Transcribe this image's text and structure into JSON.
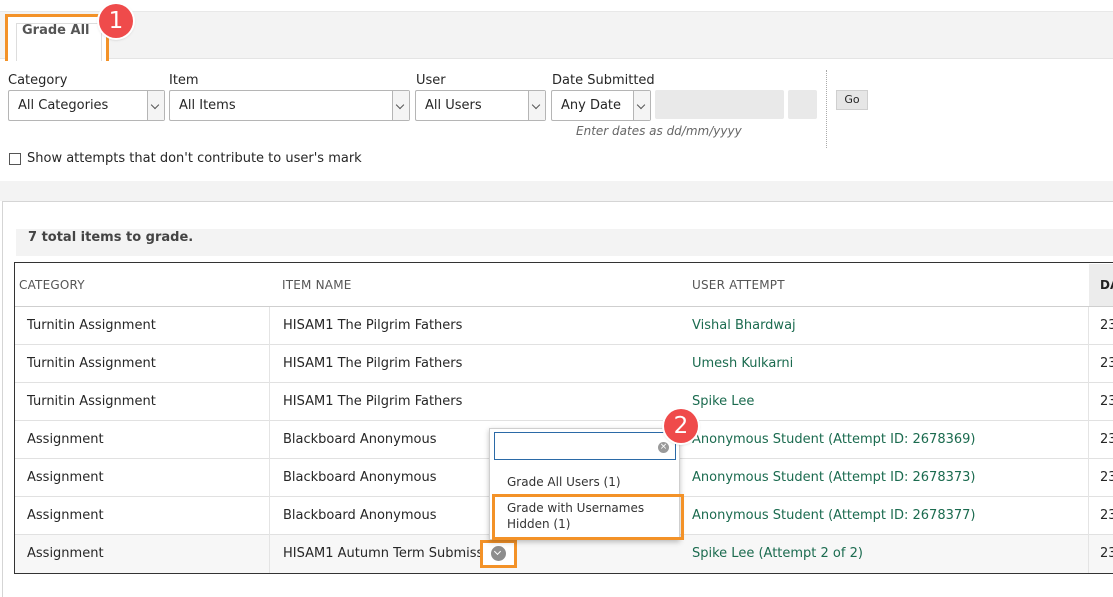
{
  "tab": {
    "label": "Grade All"
  },
  "callouts": {
    "one": "1",
    "two": "2"
  },
  "filters": {
    "category": {
      "label": "Category",
      "value": "All Categories"
    },
    "item": {
      "label": "Item",
      "value": "All Items"
    },
    "user": {
      "label": "User",
      "value": "All Users"
    },
    "date": {
      "label": "Date Submitted",
      "value": "Any Date",
      "hint": "Enter dates as dd/mm/yyyy"
    },
    "go_label": "Go",
    "checkbox_label": "Show attempts that don't contribute to user's mark"
  },
  "summary": "7 total items to grade.",
  "table": {
    "headers": {
      "category": "CATEGORY",
      "item": "ITEM NAME",
      "attempt": "USER ATTEMPT",
      "date": "DA"
    },
    "rows": [
      {
        "category": "Turnitin Assignment",
        "item": "HISAM1 The Pilgrim Fathers",
        "attempt": "Vishal Bhardwaj",
        "date": "23"
      },
      {
        "category": "Turnitin Assignment",
        "item": "HISAM1 The Pilgrim Fathers",
        "attempt": "Umesh Kulkarni",
        "date": "23"
      },
      {
        "category": "Turnitin Assignment",
        "item": "HISAM1 The Pilgrim Fathers",
        "attempt": "Spike Lee",
        "date": "23"
      },
      {
        "category": "Assignment",
        "item": "Blackboard Anonymous",
        "attempt": "Anonymous Student (Attempt ID: 2678369)",
        "date": "23"
      },
      {
        "category": "Assignment",
        "item": "Blackboard Anonymous",
        "attempt": "Anonymous Student (Attempt ID: 2678373)",
        "date": "23"
      },
      {
        "category": "Assignment",
        "item": "Blackboard Anonymous",
        "attempt": "Anonymous Student (Attempt ID: 2678377)",
        "date": "23"
      },
      {
        "category": "Assignment",
        "item": "HISAM1 Autumn Term Submission",
        "attempt": "Spike Lee (Attempt 2 of 2)",
        "date": "23"
      }
    ]
  },
  "menu": {
    "items": [
      {
        "label": "Grade All Users (1)"
      },
      {
        "line1": "Grade with Usernames",
        "line2": "Hidden (1)"
      }
    ]
  },
  "colors": {
    "accent_orange": "#f39228",
    "callout_red": "#ef4b4b",
    "link_green": "#1b6b4f"
  },
  "icons": {
    "clear": "clear-icon",
    "chevron": "chevron-down-icon"
  }
}
